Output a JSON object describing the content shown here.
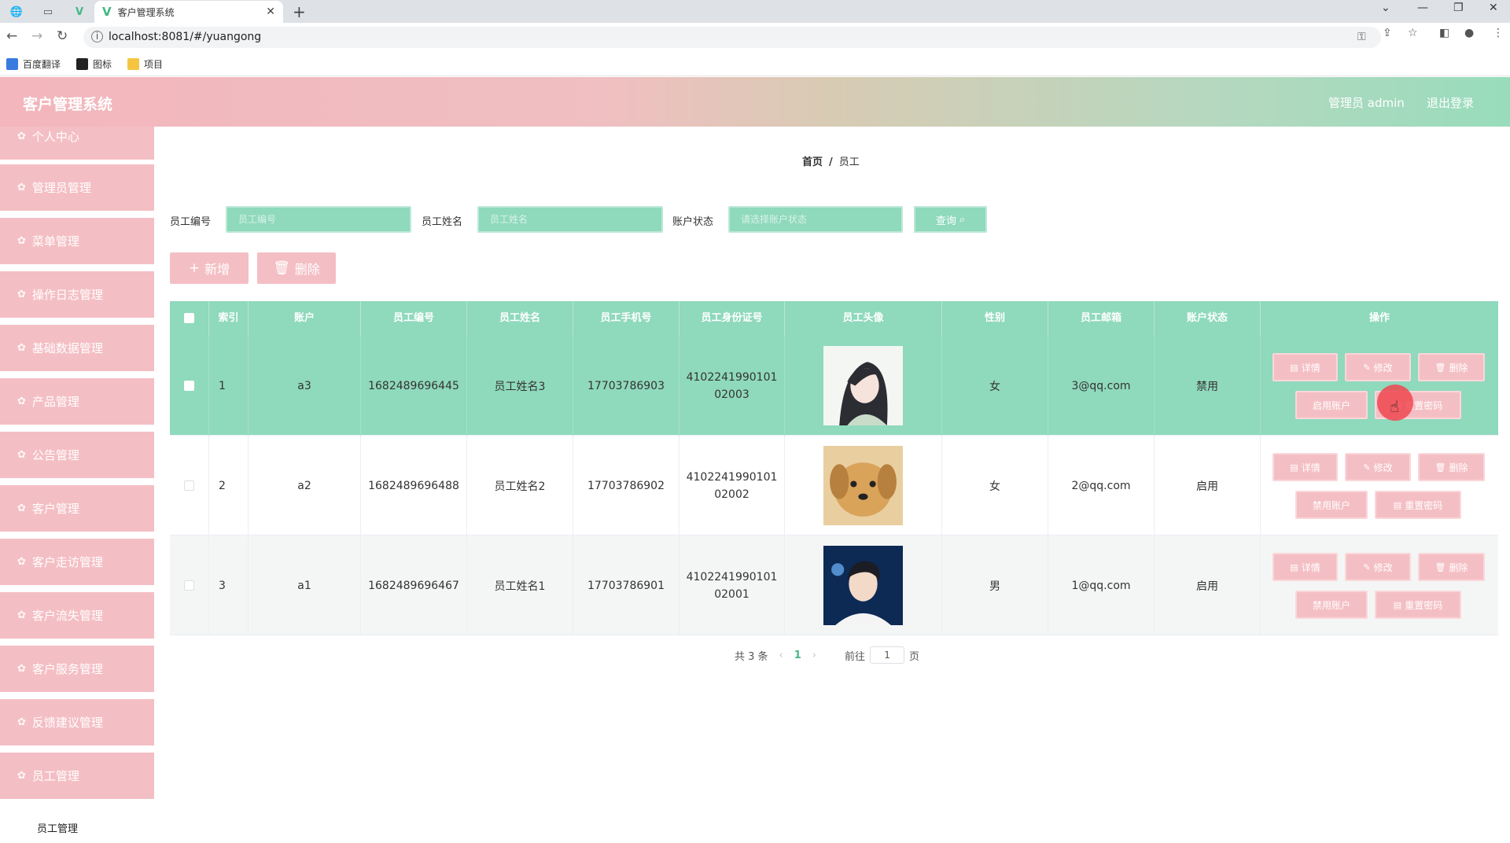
{
  "browser": {
    "tab_title": "客户管理系统",
    "url": "localhost:8081/#/yuangong",
    "bookmarks": [
      "百度翻译",
      "图标",
      "项目"
    ]
  },
  "header": {
    "title": "客户管理系统",
    "user_label": "管理员 admin",
    "logout_label": "退出登录"
  },
  "sidebar": {
    "items": [
      {
        "label": "个人中心"
      },
      {
        "label": "管理员管理"
      },
      {
        "label": "菜单管理"
      },
      {
        "label": "操作日志管理"
      },
      {
        "label": "基础数据管理"
      },
      {
        "label": "产品管理"
      },
      {
        "label": "公告管理"
      },
      {
        "label": "客户管理"
      },
      {
        "label": "客户走访管理"
      },
      {
        "label": "客户流失管理"
      },
      {
        "label": "客户服务管理"
      },
      {
        "label": "反馈建议管理"
      },
      {
        "label": "员工管理"
      }
    ],
    "active_sub": "员工管理"
  },
  "breadcrumb": {
    "home": "首页",
    "sep": "/",
    "current": "员工"
  },
  "search": {
    "emp_no_label": "员工编号",
    "emp_no_placeholder": "员工编号",
    "emp_name_label": "员工姓名",
    "emp_name_placeholder": "员工姓名",
    "status_label": "账户状态",
    "status_placeholder": "请选择账户状态",
    "query_label": "查询"
  },
  "actions": {
    "add_label": "新增",
    "delete_label": "删除"
  },
  "table": {
    "columns": [
      "索引",
      "账户",
      "员工编号",
      "员工姓名",
      "员工手机号",
      "员工身份证号",
      "员工头像",
      "性别",
      "员工邮箱",
      "账户状态",
      "操作"
    ],
    "rows": [
      {
        "index": "1",
        "account": "a3",
        "emp_no": "1682489696445",
        "name": "员工姓名3",
        "phone": "17703786903",
        "idcard1": "4102241990101",
        "idcard2": "02003",
        "gender": "女",
        "email": "3@qq.com",
        "status": "禁用",
        "toggle_label": "启用账户"
      },
      {
        "index": "2",
        "account": "a2",
        "emp_no": "1682489696488",
        "name": "员工姓名2",
        "phone": "17703786902",
        "idcard1": "4102241990101",
        "idcard2": "02002",
        "gender": "女",
        "email": "2@qq.com",
        "status": "启用",
        "toggle_label": "禁用账户"
      },
      {
        "index": "3",
        "account": "a1",
        "emp_no": "1682489696467",
        "name": "员工姓名1",
        "phone": "17703786901",
        "idcard1": "4102241990101",
        "idcard2": "02001",
        "gender": "男",
        "email": "1@qq.com",
        "status": "启用",
        "toggle_label": "禁用账户"
      }
    ],
    "op": {
      "detail": "详情",
      "edit": "修改",
      "delete": "删除",
      "reset_pwd": "重置密码"
    }
  },
  "pagination": {
    "total": "共 3 条",
    "page": "1",
    "goto_prefix": "前往",
    "goto_value": "1",
    "goto_suffix": "页"
  },
  "colors": {
    "pink": "#f4bfc4",
    "mint": "#8fd9bd"
  }
}
